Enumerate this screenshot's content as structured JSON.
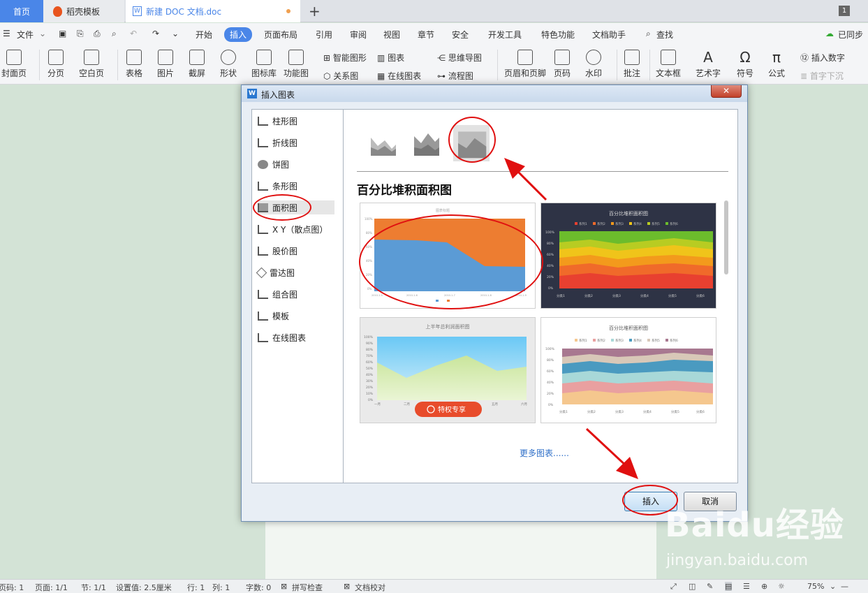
{
  "tabs": {
    "home": "首页",
    "daoke": "稻壳模板",
    "doc": "新建 DOC 文档.doc",
    "count": "1"
  },
  "menu": {
    "file": "文件",
    "items": [
      "开始",
      "插入",
      "页面布局",
      "引用",
      "审阅",
      "视图",
      "章节",
      "安全",
      "开发工具",
      "特色功能",
      "文档助手"
    ],
    "search": "查找",
    "sync": "已同步"
  },
  "ribbon": {
    "cover": "封面页",
    "pagebreak": "分页",
    "blank": "空白页",
    "table": "表格",
    "picture": "图片",
    "screenshot": "截屏",
    "shape": "形状",
    "iconlib": "图标库",
    "funcchart": "功能图",
    "smartart": "智能图形",
    "relation": "关系图",
    "chart": "图表",
    "onlinechart": "在线图表",
    "mindmap": "思维导图",
    "flowchart": "流程图",
    "headerfooter": "页眉和页脚",
    "pagenum": "页码",
    "watermark": "水印",
    "comment": "批注",
    "textbox": "文本框",
    "wordart": "艺术字",
    "symbol": "符号",
    "formula": "公式",
    "insertnum": "插入数字",
    "dropcap": "首字下沉"
  },
  "status": {
    "pagecode": "页码: 1",
    "page": "页面: 1/1",
    "section": "节: 1/1",
    "setting": "设置值: 2.5厘米",
    "row": "行: 1",
    "col": "列: 1",
    "words": "字数: 0",
    "spell": "拼写检查",
    "proof": "文档校对",
    "zoom": "75%"
  },
  "dialog": {
    "title": "插入图表",
    "heading": "百分比堆积面积图",
    "more": "更多图表......",
    "insert": "插入",
    "cancel": "取消",
    "categories": [
      "柱形图",
      "折线图",
      "饼图",
      "条形图",
      "面积图",
      "X Y（散点图）",
      "股价图",
      "雷达图",
      "组合图",
      "模板",
      "在线图表"
    ],
    "selected": "面积图",
    "thumb2": {
      "title": "百分比堆积面积图",
      "legend": [
        "系列1",
        "系列2",
        "系列3",
        "系列4",
        "系列5",
        "系列6"
      ],
      "yticks": [
        "100%",
        "80%",
        "60%",
        "40%",
        "20%",
        "0%"
      ],
      "xticks": [
        "分类1",
        "分类2",
        "分类3",
        "分类4",
        "分类5",
        "分类6"
      ]
    },
    "thumb3": {
      "title": "上半年总利润面积图",
      "yticks": [
        "100%",
        "90%",
        "80%",
        "70%",
        "60%",
        "50%",
        "40%",
        "30%",
        "20%",
        "10%",
        "0%"
      ],
      "xticks": [
        "一月",
        "二月",
        "五月",
        "六月"
      ],
      "badge": "特权专享"
    },
    "thumb4": {
      "title": "百分比堆积面积图",
      "legend": [
        "系列1",
        "系列2",
        "系列3",
        "系列4",
        "系列5",
        "系列6"
      ],
      "yticks": [
        "100%",
        "80%",
        "60%",
        "40%",
        "20%",
        "0%"
      ],
      "xticks": [
        "分类1",
        "分类2",
        "分类3",
        "分类4",
        "分类5",
        "分类6"
      ]
    }
  },
  "colors": {
    "accent": "#4a86e8",
    "annotation": "#e01010",
    "orange": "#ed7d31",
    "blue": "#5b9bd5"
  },
  "watermark": {
    "logo": "Baidu经验",
    "url": "jingyan.baidu.com"
  }
}
